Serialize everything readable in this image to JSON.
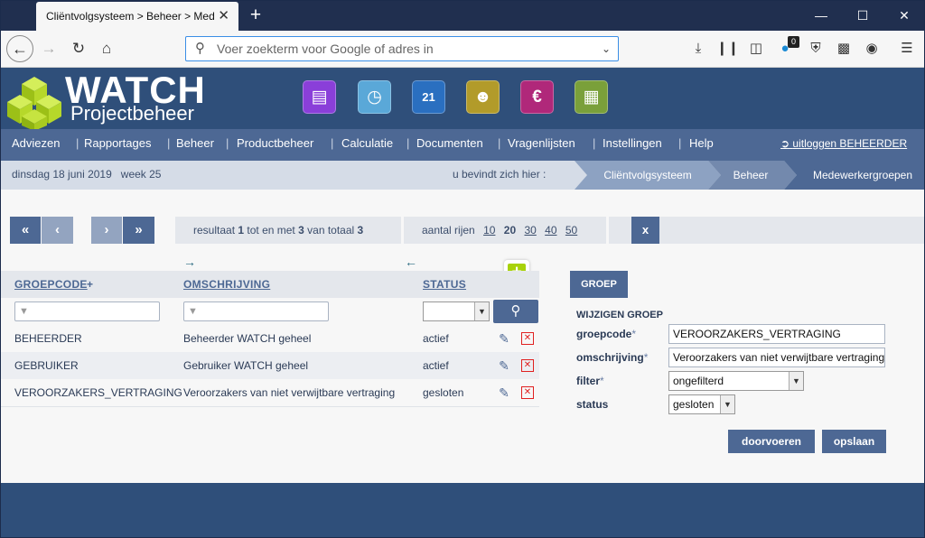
{
  "browser": {
    "tab_title": "Cliëntvolgsysteem > Beheer > Med",
    "tab_close": "✕",
    "new_tab": "+",
    "url_placeholder": "Voer zoekterm voor Google of adres in",
    "notification_count": "0"
  },
  "app": {
    "logo_title": "WATCH",
    "logo_subtitle": "Projectbeheer",
    "menu": [
      "Adviezen",
      "Rapportages",
      "Beheer",
      "Productbeheer",
      "Calculatie",
      "Documenten",
      "Vragenlijsten",
      "Instellingen",
      "Help"
    ],
    "logout_label": "uitloggen BEHEERDER",
    "date": "dinsdag 18 juni 2019",
    "week": "week 25",
    "location_label": "u bevindt zich hier :",
    "breadcrumbs": [
      "Cliëntvolgsysteem",
      "Beheer",
      "Medewerkergroepen"
    ]
  },
  "pager": {
    "first": "«",
    "prev": "‹",
    "next": "›",
    "last": "»",
    "result_prefix": "resultaat",
    "from": "1",
    "mid": "tot en met",
    "to": "3",
    "total_label": "van totaal",
    "total": "3",
    "rows_label": "aantal rijen",
    "row_options": [
      "10",
      "20",
      "30",
      "40",
      "50"
    ],
    "selected_rows": "20",
    "export_label": "x"
  },
  "table": {
    "columns": {
      "groepcode": "GROEPCODE",
      "add_sort": "+",
      "omschrijving": "OMSCHRIJVING",
      "status": "STATUS"
    },
    "add_button": "+",
    "rows": [
      {
        "groepcode": "BEHEERDER",
        "omschrijving": "Beheerder WATCH geheel",
        "status": "actief"
      },
      {
        "groepcode": "GEBRUIKER",
        "omschrijving": "Gebruiker WATCH geheel",
        "status": "actief"
      },
      {
        "groepcode": "VEROORZAKERS_VERTRAGING",
        "omschrijving": "Veroorzakers van niet verwijtbare vertraging",
        "status": "gesloten"
      }
    ]
  },
  "form": {
    "tab_label": "GROEP",
    "heading": "WIJZIGEN GROEP",
    "groepcode_label": "groepcode",
    "groepcode_value": "VEROORZAKERS_VERTRAGING",
    "omschrijving_label": "omschrijving",
    "omschrijving_value": "Veroorzakers van niet verwijtbare vertraging",
    "filter_label": "filter",
    "filter_value": "ongefilterd",
    "status_label": "status",
    "status_value": "gesloten",
    "required_mark": "*",
    "btn_apply": "doorvoeren",
    "btn_save": "opslaan"
  },
  "colors": {
    "header": "#2f4f7a",
    "menu": "#4d6894",
    "accent_green": "#a8d20a",
    "delete_red": "#e02020"
  }
}
